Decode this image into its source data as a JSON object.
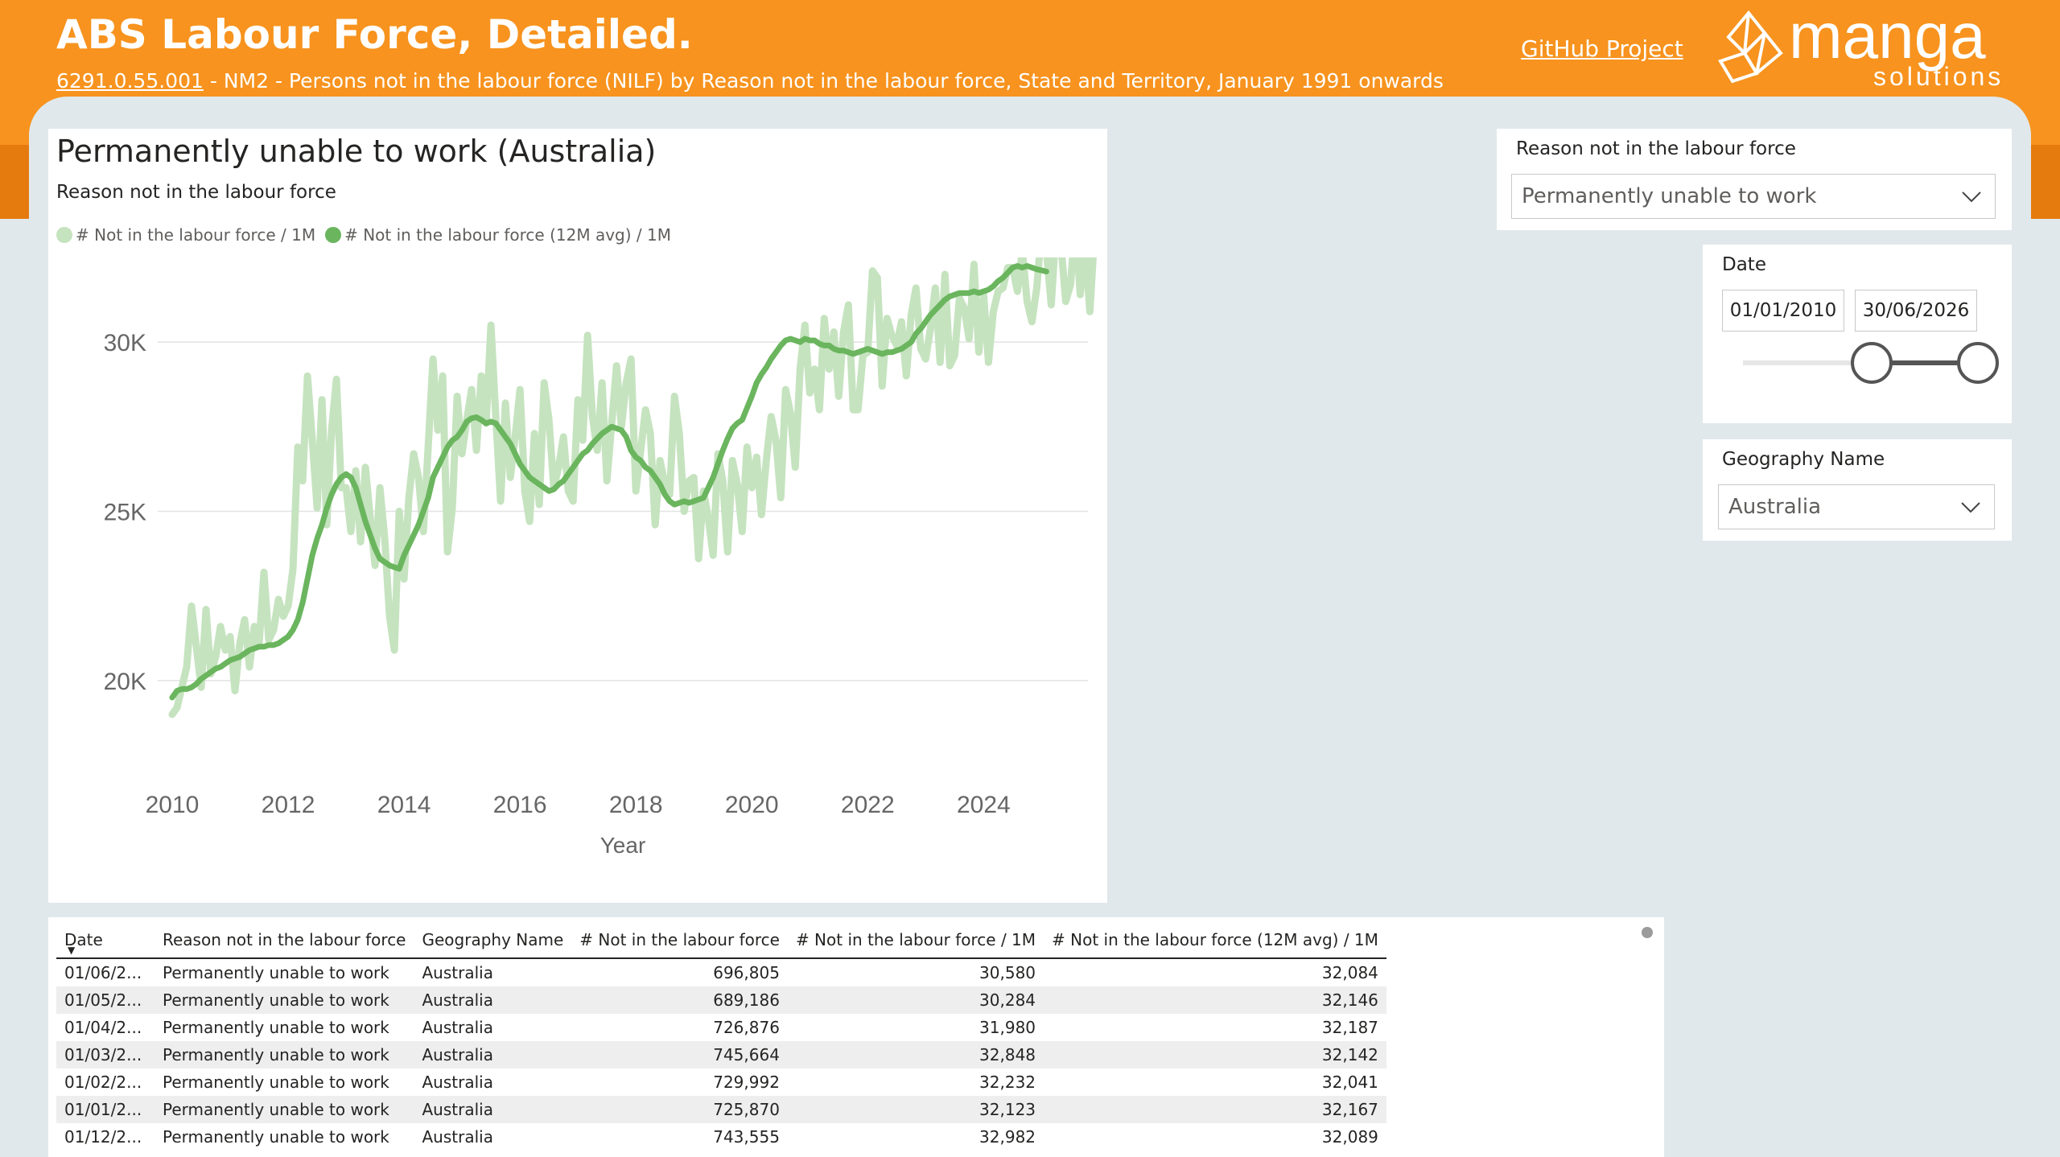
{
  "header": {
    "title": "ABS Labour Force, Detailed.",
    "series_id": "6291.0.55.001",
    "subtitle_rest": " - NM2 - Persons not in the labour force (NILF) by Reason not in the labour force, State and Territory, January 1991 onwards",
    "github_link": "GitHub Project",
    "logo_text": "manga",
    "logo_subtext": "solutions"
  },
  "chart_title": "Permanently unable to work (Australia)",
  "chart_subtitle": "Reason not in the labour force",
  "chart_data": {
    "type": "line",
    "x_label": "Year",
    "x_ticks": [
      "2010",
      "2012",
      "2014",
      "2016",
      "2018",
      "2020",
      "2022",
      "2024"
    ],
    "y_ticks": [
      {
        "value": 20000,
        "label": "20K"
      },
      {
        "value": 25000,
        "label": "25K"
      },
      {
        "value": 30000,
        "label": "30K"
      }
    ],
    "x_range": [
      2009.75,
      2025.8
    ],
    "y_range": [
      18000,
      32500
    ],
    "grid": true,
    "legend_position": "top-left",
    "series": [
      {
        "name": "# Not in the labour force / 1M",
        "color": "#c5e3bf",
        "x_start": 2010.0,
        "x_step": 0.0833333,
        "values": [
          19000,
          19200,
          19800,
          20400,
          22200,
          21000,
          19800,
          22100,
          20200,
          20700,
          21600,
          20900,
          21300,
          19700,
          21100,
          21800,
          20400,
          21600,
          21100,
          23200,
          21200,
          21500,
          22400,
          21900,
          22200,
          23300,
          26900,
          25900,
          29000,
          27100,
          25100,
          28300,
          24600,
          27400,
          28900,
          25700,
          25700,
          24400,
          26200,
          24100,
          26300,
          24800,
          23400,
          25700,
          24200,
          21900,
          20900,
          25000,
          23000,
          25400,
          26700,
          26000,
          24400,
          26900,
          29500,
          27400,
          29000,
          23800,
          25100,
          28400,
          26700,
          27700,
          28600,
          26800,
          29000,
          27600,
          30500,
          27800,
          25300,
          28200,
          26000,
          27200,
          28600,
          25600,
          24700,
          27300,
          25200,
          28800,
          27700,
          25700,
          26300,
          27200,
          25600,
          25300,
          28300,
          27100,
          30200,
          27800,
          26800,
          28800,
          25900,
          27600,
          29300,
          27500,
          28800,
          29500,
          25600,
          26800,
          28000,
          27300,
          24600,
          26500,
          25800,
          25500,
          28400,
          27300,
          25000,
          25900,
          26000,
          23600,
          25600,
          24800,
          23700,
          26700,
          25900,
          23800,
          26500,
          25800,
          24400,
          26900,
          25700,
          26600,
          24900,
          26500,
          27800,
          27100,
          25400,
          28600,
          27900,
          26300,
          29200,
          30500,
          28500,
          29200,
          28000,
          30700,
          29200,
          30300,
          28400,
          30300,
          31100,
          28000,
          28000,
          29600,
          29700,
          32100,
          31900,
          28700,
          30700,
          30200,
          29900,
          30600,
          29000,
          30800,
          31600,
          29800,
          29500,
          30400,
          31600,
          29400,
          32000,
          29300,
          29600,
          31300,
          31000,
          30100,
          32300,
          29700,
          31400,
          29400,
          30900,
          31500,
          31600,
          32200,
          32200,
          31500,
          32700,
          31200,
          30600,
          31600,
          33300,
          32700,
          31100,
          33400,
          32900,
          31200,
          31700,
          33600,
          31400,
          32900,
          30900,
          33300,
          33500,
          33500,
          33700,
          32700,
          32200,
          32600,
          32100,
          31700,
          30300,
          30580
        ]
      },
      {
        "name": "# Not in the labour force (12M avg) / 1M",
        "color": "#6ab55e",
        "x_start": 2010.0,
        "x_step": 0.0833333,
        "values": [
          19500,
          19700,
          19750,
          19750,
          19800,
          19900,
          20050,
          20150,
          20250,
          20350,
          20400,
          20500,
          20600,
          20650,
          20700,
          20800,
          20900,
          20950,
          21000,
          21000,
          21050,
          21050,
          21100,
          21200,
          21300,
          21500,
          21800,
          22300,
          23000,
          23700,
          24200,
          24600,
          25100,
          25500,
          25800,
          26000,
          26100,
          26000,
          25700,
          25200,
          24700,
          24300,
          23900,
          23600,
          23500,
          23400,
          23350,
          23300,
          23700,
          24000,
          24300,
          24600,
          25000,
          25400,
          26000,
          26300,
          26600,
          26900,
          27100,
          27200,
          27400,
          27650,
          27750,
          27780,
          27700,
          27600,
          27650,
          27600,
          27400,
          27200,
          27000,
          26700,
          26400,
          26200,
          26000,
          25900,
          25800,
          25700,
          25600,
          25650,
          25800,
          25900,
          26100,
          26300,
          26500,
          26700,
          26800,
          27000,
          27150,
          27300,
          27400,
          27500,
          27450,
          27400,
          27200,
          26800,
          26600,
          26500,
          26300,
          26200,
          26000,
          25800,
          25500,
          25300,
          25200,
          25250,
          25300,
          25250,
          25300,
          25350,
          25400,
          25700,
          26000,
          26400,
          26800,
          27150,
          27450,
          27600,
          27700,
          28050,
          28400,
          28800,
          29050,
          29250,
          29500,
          29700,
          29900,
          30050,
          30100,
          30050,
          30000,
          30100,
          30050,
          30050,
          29950,
          29900,
          29900,
          29800,
          29750,
          29750,
          29700,
          29650,
          29700,
          29750,
          29800,
          29750,
          29700,
          29650,
          29700,
          29700,
          29750,
          29800,
          29900,
          30000,
          30250,
          30400,
          30600,
          30800,
          30950,
          31100,
          31250,
          31350,
          31400,
          31450,
          31450,
          31450,
          31500,
          31450,
          31500,
          31550,
          31650,
          31800,
          31900,
          32050,
          32200,
          32250,
          32200,
          32250,
          32200,
          32150,
          32120,
          32084
        ]
      }
    ]
  },
  "slicers": {
    "reason": {
      "label": "Reason not in the labour force",
      "value": "Permanently unable to work"
    },
    "date": {
      "label": "Date",
      "start": "01/01/2010",
      "end": "30/06/2026"
    },
    "geography": {
      "label": "Geography Name",
      "value": "Australia"
    }
  },
  "table": {
    "columns": [
      "Date",
      "Reason not in the labour force",
      "Geography Name",
      "# Not in the labour force",
      "# Not in the labour force / 1M",
      "# Not in the labour force (12M avg) / 1M"
    ],
    "rows": [
      [
        "01/06/2...",
        "Permanently unable to work",
        "Australia",
        "696,805",
        "30,580",
        "32,084"
      ],
      [
        "01/05/2...",
        "Permanently unable to work",
        "Australia",
        "689,186",
        "30,284",
        "32,146"
      ],
      [
        "01/04/2...",
        "Permanently unable to work",
        "Australia",
        "726,876",
        "31,980",
        "32,187"
      ],
      [
        "01/03/2...",
        "Permanently unable to work",
        "Australia",
        "745,664",
        "32,848",
        "32,142"
      ],
      [
        "01/02/2...",
        "Permanently unable to work",
        "Australia",
        "729,992",
        "32,232",
        "32,041"
      ],
      [
        "01/01/2...",
        "Permanently unable to work",
        "Australia",
        "725,870",
        "32,123",
        "32,167"
      ],
      [
        "01/12/2...",
        "Permanently unable to work",
        "Australia",
        "743,555",
        "32,982",
        "32,089"
      ]
    ]
  }
}
